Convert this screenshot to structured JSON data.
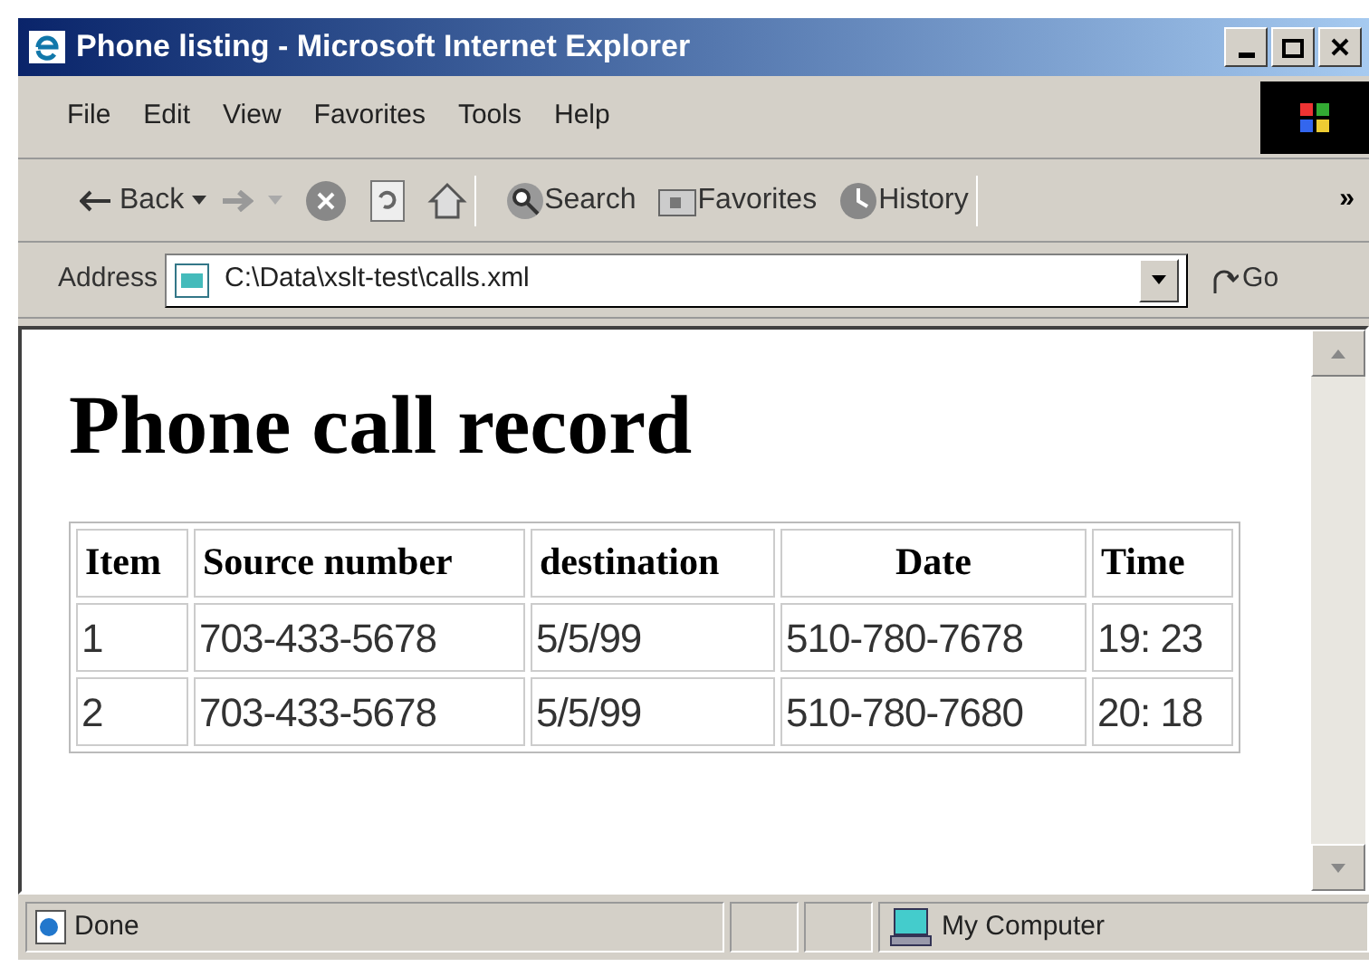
{
  "window": {
    "title": "Phone listing - Microsoft Internet Explorer"
  },
  "menu": [
    "File",
    "Edit",
    "View",
    "Favorites",
    "Tools",
    "Help"
  ],
  "toolbar": [
    {
      "kind": "back",
      "label": "Back"
    },
    {
      "kind": "forward"
    },
    {
      "kind": "stop"
    },
    {
      "kind": "refresh"
    },
    {
      "kind": "home"
    },
    {
      "kind": "search",
      "label": "Search"
    },
    {
      "kind": "favorites",
      "label": "Favorites"
    },
    {
      "kind": "history",
      "label": "History"
    },
    {
      "kind": "more",
      "label": "»"
    }
  ],
  "address": {
    "label": "Address",
    "value": "C:\\Data\\xslt-test\\calls.xml",
    "go": "Go"
  },
  "page": {
    "heading": "Phone call record",
    "table": {
      "columns": [
        "Item",
        "Source number",
        "destination",
        "Date",
        "Time"
      ],
      "rows": [
        [
          "1",
          "703-433-5678",
          "5/5/99",
          "510-780-7678",
          "19: 23"
        ],
        [
          "2",
          "703-433-5678",
          "5/5/99",
          "510-780-7680",
          "20: 18"
        ]
      ]
    }
  },
  "status_bar": {
    "text": "Done",
    "zone": "My Computer"
  }
}
